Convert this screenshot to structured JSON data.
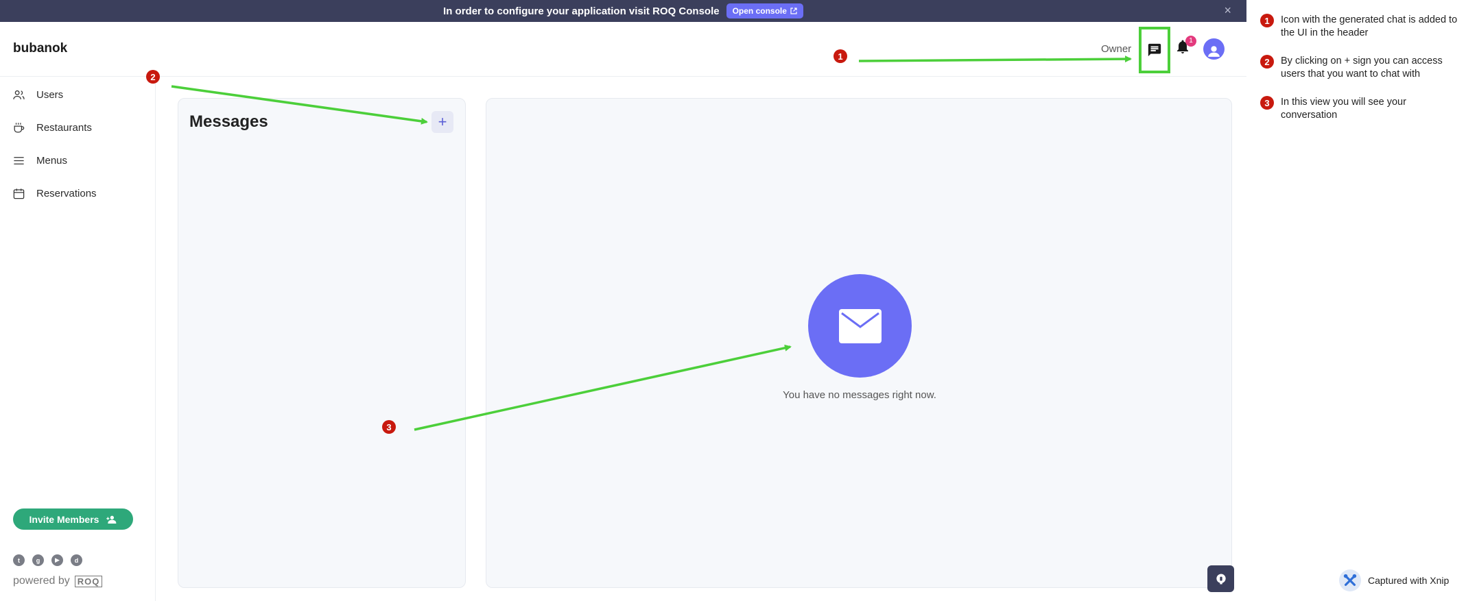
{
  "banner": {
    "text": "In order to configure your application visit ROQ Console",
    "button_label": "Open console",
    "close_glyph": "×"
  },
  "header": {
    "app_name": "bubanok",
    "role": "Owner",
    "notification_count": "1",
    "icons": [
      "chat-icon",
      "bell-icon",
      "user-icon"
    ]
  },
  "sidebar": {
    "items": [
      {
        "label": "Users",
        "icon": "users-icon"
      },
      {
        "label": "Restaurants",
        "icon": "cup-icon"
      },
      {
        "label": "Menus",
        "icon": "menu-lines-icon"
      },
      {
        "label": "Reservations",
        "icon": "calendar-icon"
      }
    ],
    "invite_label": "Invite Members",
    "social_icons": [
      "twitter-icon",
      "github-icon",
      "youtube-icon",
      "discord-icon"
    ],
    "powered_by": "powered by",
    "powered_logo": "ROQ"
  },
  "messages": {
    "title": "Messages",
    "add_glyph": "+",
    "empty_text": "You have no messages right now."
  },
  "annotations": {
    "marker_color": "#c8190e",
    "arrow_color": "#4ccf3a",
    "markers": [
      "1",
      "2",
      "3"
    ],
    "notes": [
      {
        "num": "1",
        "text": "Icon with the generated chat is added to the UI in the header"
      },
      {
        "num": "2",
        "text": "By clicking on + sign you can access users that you want to chat with"
      },
      {
        "num": "3",
        "text": "In this view you will see your conversation"
      }
    ]
  },
  "watermark": {
    "text": "Captured with Xnip"
  },
  "colors": {
    "banner": "#3b3f5c",
    "accent": "#6b6ef5",
    "invite": "#2ea87a",
    "badge": "#e33a7d"
  }
}
